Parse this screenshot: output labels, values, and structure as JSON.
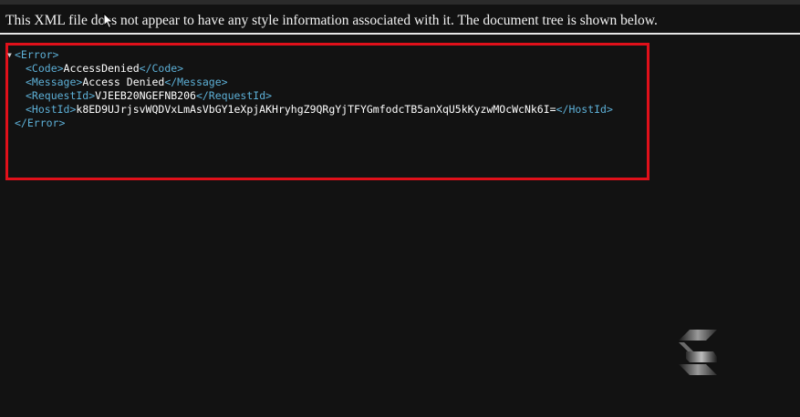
{
  "info_message": "This XML file does not appear to have any style information associated with it. The document tree is shown below.",
  "xml": {
    "root_open": "<Error>",
    "root_close": "</Error>",
    "children": [
      {
        "open": "<Code>",
        "value": "AccessDenied",
        "close": "</Code>"
      },
      {
        "open": "<Message>",
        "value": "Access Denied",
        "close": "</Message>"
      },
      {
        "open": "<RequestId>",
        "value": "VJEEB20NGEFNB206",
        "close": "</RequestId>"
      },
      {
        "open": "<HostId>",
        "value": "k8ED9UJrjsvWQDVxLmAsVbGY1eXpjAKHryhgZ9QRgYjTFYGmfodcTB5anXqU5kKyzwMOcWcNk6I=",
        "close": "</HostId>"
      }
    ]
  },
  "colors": {
    "background": "#121212",
    "tag": "#5db0d7",
    "value": "#ffffff",
    "highlight": "#e0101a"
  },
  "icons": {
    "toggle": "triangle-down-icon",
    "cursor": "mouse-pointer-icon",
    "logo": "s-logo-icon"
  }
}
